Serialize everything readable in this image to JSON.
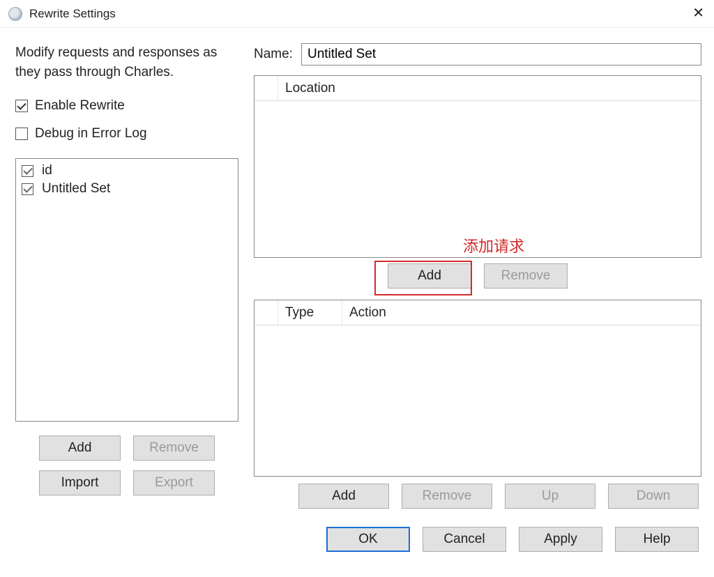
{
  "window": {
    "title": "Rewrite Settings",
    "close_glyph": "✕"
  },
  "left": {
    "description": "Modify requests and responses as they pass through Charles.",
    "enable_label": "Enable Rewrite",
    "enable_checked": true,
    "debug_label": "Debug in Error Log",
    "debug_checked": false,
    "sets": [
      {
        "label": "id",
        "checked": true
      },
      {
        "label": "Untitled Set",
        "checked": true
      }
    ],
    "buttons": {
      "add": "Add",
      "remove": "Remove",
      "import": "Import",
      "export": "Export"
    }
  },
  "right": {
    "name_label": "Name:",
    "name_value": "Untitled Set",
    "location_header": "Location",
    "loc_buttons": {
      "add": "Add",
      "remove": "Remove"
    },
    "type_header": "Type",
    "action_header": "Action",
    "rule_buttons": {
      "add": "Add",
      "remove": "Remove",
      "up": "Up",
      "down": "Down"
    }
  },
  "dialog_buttons": {
    "ok": "OK",
    "cancel": "Cancel",
    "apply": "Apply",
    "help": "Help"
  },
  "annotation": {
    "text": "添加请求"
  }
}
